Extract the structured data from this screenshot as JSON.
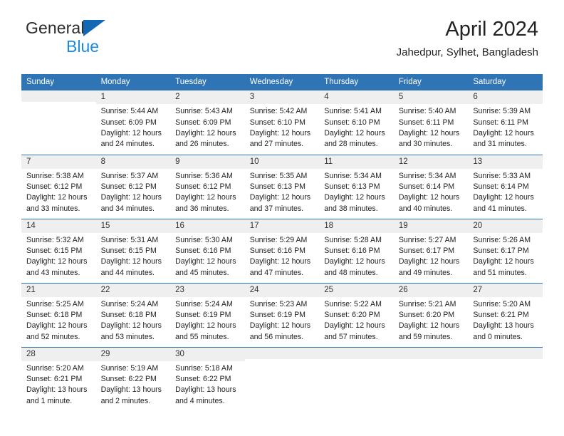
{
  "brand": {
    "name_part1": "General",
    "name_part2": "Blue",
    "triangle_color": "#1268b3",
    "blue_color": "#1b8ae0"
  },
  "header": {
    "title": "April 2024",
    "subtitle": "Jahedpur, Sylhet, Bangladesh"
  },
  "theme": {
    "header_bg": "#2f74b5",
    "daynum_bg": "#efefef",
    "grid_line": "#2f74b5"
  },
  "weekday_headers": [
    "Sunday",
    "Monday",
    "Tuesday",
    "Wednesday",
    "Thursday",
    "Friday",
    "Saturday"
  ],
  "weeks": [
    [
      {
        "day": "",
        "blank": true,
        "sunrise": "",
        "sunset": "",
        "daylight_line1": "",
        "daylight_line2": ""
      },
      {
        "day": "1",
        "blank": false,
        "sunrise": "Sunrise: 5:44 AM",
        "sunset": "Sunset: 6:09 PM",
        "daylight_line1": "Daylight: 12 hours",
        "daylight_line2": "and 24 minutes."
      },
      {
        "day": "2",
        "blank": false,
        "sunrise": "Sunrise: 5:43 AM",
        "sunset": "Sunset: 6:09 PM",
        "daylight_line1": "Daylight: 12 hours",
        "daylight_line2": "and 26 minutes."
      },
      {
        "day": "3",
        "blank": false,
        "sunrise": "Sunrise: 5:42 AM",
        "sunset": "Sunset: 6:10 PM",
        "daylight_line1": "Daylight: 12 hours",
        "daylight_line2": "and 27 minutes."
      },
      {
        "day": "4",
        "blank": false,
        "sunrise": "Sunrise: 5:41 AM",
        "sunset": "Sunset: 6:10 PM",
        "daylight_line1": "Daylight: 12 hours",
        "daylight_line2": "and 28 minutes."
      },
      {
        "day": "5",
        "blank": false,
        "sunrise": "Sunrise: 5:40 AM",
        "sunset": "Sunset: 6:11 PM",
        "daylight_line1": "Daylight: 12 hours",
        "daylight_line2": "and 30 minutes."
      },
      {
        "day": "6",
        "blank": false,
        "sunrise": "Sunrise: 5:39 AM",
        "sunset": "Sunset: 6:11 PM",
        "daylight_line1": "Daylight: 12 hours",
        "daylight_line2": "and 31 minutes."
      }
    ],
    [
      {
        "day": "7",
        "blank": false,
        "sunrise": "Sunrise: 5:38 AM",
        "sunset": "Sunset: 6:12 PM",
        "daylight_line1": "Daylight: 12 hours",
        "daylight_line2": "and 33 minutes."
      },
      {
        "day": "8",
        "blank": false,
        "sunrise": "Sunrise: 5:37 AM",
        "sunset": "Sunset: 6:12 PM",
        "daylight_line1": "Daylight: 12 hours",
        "daylight_line2": "and 34 minutes."
      },
      {
        "day": "9",
        "blank": false,
        "sunrise": "Sunrise: 5:36 AM",
        "sunset": "Sunset: 6:12 PM",
        "daylight_line1": "Daylight: 12 hours",
        "daylight_line2": "and 36 minutes."
      },
      {
        "day": "10",
        "blank": false,
        "sunrise": "Sunrise: 5:35 AM",
        "sunset": "Sunset: 6:13 PM",
        "daylight_line1": "Daylight: 12 hours",
        "daylight_line2": "and 37 minutes."
      },
      {
        "day": "11",
        "blank": false,
        "sunrise": "Sunrise: 5:34 AM",
        "sunset": "Sunset: 6:13 PM",
        "daylight_line1": "Daylight: 12 hours",
        "daylight_line2": "and 38 minutes."
      },
      {
        "day": "12",
        "blank": false,
        "sunrise": "Sunrise: 5:34 AM",
        "sunset": "Sunset: 6:14 PM",
        "daylight_line1": "Daylight: 12 hours",
        "daylight_line2": "and 40 minutes."
      },
      {
        "day": "13",
        "blank": false,
        "sunrise": "Sunrise: 5:33 AM",
        "sunset": "Sunset: 6:14 PM",
        "daylight_line1": "Daylight: 12 hours",
        "daylight_line2": "and 41 minutes."
      }
    ],
    [
      {
        "day": "14",
        "blank": false,
        "sunrise": "Sunrise: 5:32 AM",
        "sunset": "Sunset: 6:15 PM",
        "daylight_line1": "Daylight: 12 hours",
        "daylight_line2": "and 43 minutes."
      },
      {
        "day": "15",
        "blank": false,
        "sunrise": "Sunrise: 5:31 AM",
        "sunset": "Sunset: 6:15 PM",
        "daylight_line1": "Daylight: 12 hours",
        "daylight_line2": "and 44 minutes."
      },
      {
        "day": "16",
        "blank": false,
        "sunrise": "Sunrise: 5:30 AM",
        "sunset": "Sunset: 6:16 PM",
        "daylight_line1": "Daylight: 12 hours",
        "daylight_line2": "and 45 minutes."
      },
      {
        "day": "17",
        "blank": false,
        "sunrise": "Sunrise: 5:29 AM",
        "sunset": "Sunset: 6:16 PM",
        "daylight_line1": "Daylight: 12 hours",
        "daylight_line2": "and 47 minutes."
      },
      {
        "day": "18",
        "blank": false,
        "sunrise": "Sunrise: 5:28 AM",
        "sunset": "Sunset: 6:16 PM",
        "daylight_line1": "Daylight: 12 hours",
        "daylight_line2": "and 48 minutes."
      },
      {
        "day": "19",
        "blank": false,
        "sunrise": "Sunrise: 5:27 AM",
        "sunset": "Sunset: 6:17 PM",
        "daylight_line1": "Daylight: 12 hours",
        "daylight_line2": "and 49 minutes."
      },
      {
        "day": "20",
        "blank": false,
        "sunrise": "Sunrise: 5:26 AM",
        "sunset": "Sunset: 6:17 PM",
        "daylight_line1": "Daylight: 12 hours",
        "daylight_line2": "and 51 minutes."
      }
    ],
    [
      {
        "day": "21",
        "blank": false,
        "sunrise": "Sunrise: 5:25 AM",
        "sunset": "Sunset: 6:18 PM",
        "daylight_line1": "Daylight: 12 hours",
        "daylight_line2": "and 52 minutes."
      },
      {
        "day": "22",
        "blank": false,
        "sunrise": "Sunrise: 5:24 AM",
        "sunset": "Sunset: 6:18 PM",
        "daylight_line1": "Daylight: 12 hours",
        "daylight_line2": "and 53 minutes."
      },
      {
        "day": "23",
        "blank": false,
        "sunrise": "Sunrise: 5:24 AM",
        "sunset": "Sunset: 6:19 PM",
        "daylight_line1": "Daylight: 12 hours",
        "daylight_line2": "and 55 minutes."
      },
      {
        "day": "24",
        "blank": false,
        "sunrise": "Sunrise: 5:23 AM",
        "sunset": "Sunset: 6:19 PM",
        "daylight_line1": "Daylight: 12 hours",
        "daylight_line2": "and 56 minutes."
      },
      {
        "day": "25",
        "blank": false,
        "sunrise": "Sunrise: 5:22 AM",
        "sunset": "Sunset: 6:20 PM",
        "daylight_line1": "Daylight: 12 hours",
        "daylight_line2": "and 57 minutes."
      },
      {
        "day": "26",
        "blank": false,
        "sunrise": "Sunrise: 5:21 AM",
        "sunset": "Sunset: 6:20 PM",
        "daylight_line1": "Daylight: 12 hours",
        "daylight_line2": "and 59 minutes."
      },
      {
        "day": "27",
        "blank": false,
        "sunrise": "Sunrise: 5:20 AM",
        "sunset": "Sunset: 6:21 PM",
        "daylight_line1": "Daylight: 13 hours",
        "daylight_line2": "and 0 minutes."
      }
    ],
    [
      {
        "day": "28",
        "blank": false,
        "sunrise": "Sunrise: 5:20 AM",
        "sunset": "Sunset: 6:21 PM",
        "daylight_line1": "Daylight: 13 hours",
        "daylight_line2": "and 1 minute."
      },
      {
        "day": "29",
        "blank": false,
        "sunrise": "Sunrise: 5:19 AM",
        "sunset": "Sunset: 6:22 PM",
        "daylight_line1": "Daylight: 13 hours",
        "daylight_line2": "and 2 minutes."
      },
      {
        "day": "30",
        "blank": false,
        "sunrise": "Sunrise: 5:18 AM",
        "sunset": "Sunset: 6:22 PM",
        "daylight_line1": "Daylight: 13 hours",
        "daylight_line2": "and 4 minutes."
      },
      {
        "day": "",
        "blank": true,
        "sunrise": "",
        "sunset": "",
        "daylight_line1": "",
        "daylight_line2": ""
      },
      {
        "day": "",
        "blank": true,
        "sunrise": "",
        "sunset": "",
        "daylight_line1": "",
        "daylight_line2": ""
      },
      {
        "day": "",
        "blank": true,
        "sunrise": "",
        "sunset": "",
        "daylight_line1": "",
        "daylight_line2": ""
      },
      {
        "day": "",
        "blank": true,
        "sunrise": "",
        "sunset": "",
        "daylight_line1": "",
        "daylight_line2": ""
      }
    ]
  ]
}
